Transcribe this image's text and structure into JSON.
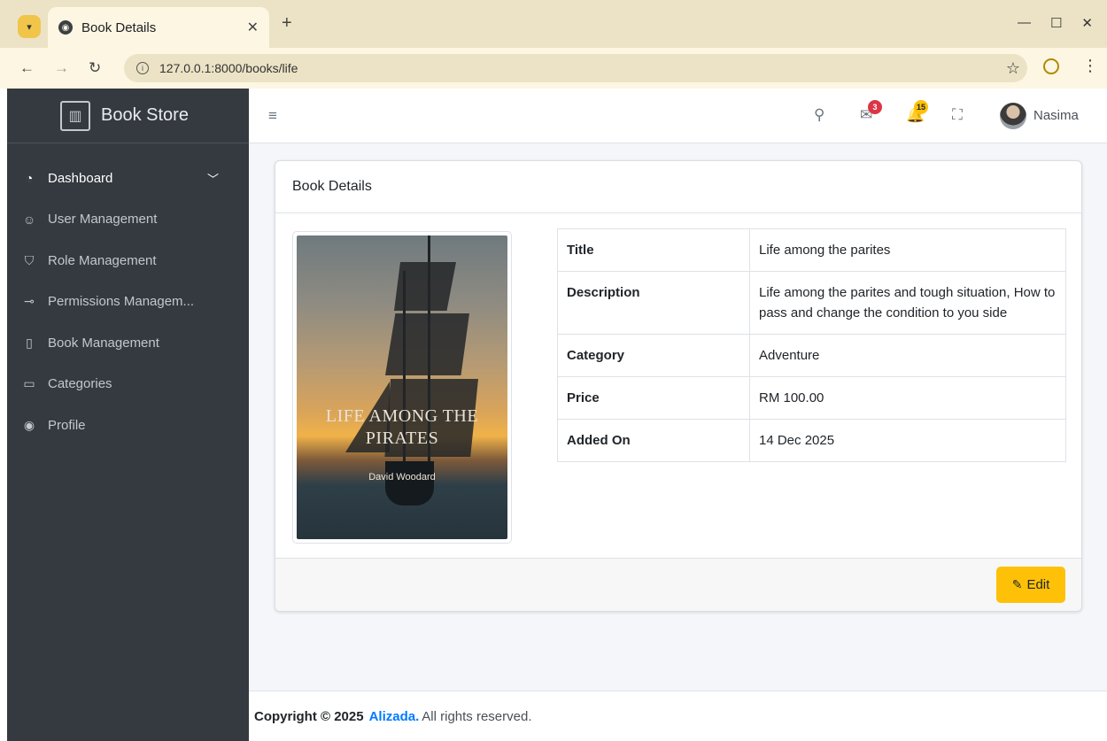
{
  "browser": {
    "tab_title": "Book Details",
    "url": "127.0.0.1:8000/books/life"
  },
  "sidebar": {
    "brand": "Book Store",
    "items": [
      {
        "label": "Dashboard",
        "icon": "gauge-icon"
      },
      {
        "label": "User Management",
        "icon": "users-icon"
      },
      {
        "label": "Role Management",
        "icon": "shield-icon"
      },
      {
        "label": "Permissions Managem...",
        "icon": "key-icon"
      },
      {
        "label": "Book Management",
        "icon": "book-open-icon"
      },
      {
        "label": "Categories",
        "icon": "folder-icon"
      },
      {
        "label": "Profile",
        "icon": "user-circle-icon"
      }
    ]
  },
  "topnav": {
    "messages_count": "3",
    "notifications_count": "15",
    "user_name": "Nasima"
  },
  "card": {
    "title": "Book Details",
    "cover": {
      "title_line1": "LIFE AMONG THE",
      "title_line2": "PIRATES",
      "author": "David Woodard"
    },
    "rows": [
      {
        "key": "Title",
        "value": "Life among the parites"
      },
      {
        "key": "Description",
        "value": "Life among the parites and tough situation, How to pass and change the condition to you side"
      },
      {
        "key": "Category",
        "value": "Adventure"
      },
      {
        "key": "Price",
        "value": "RM 100.00"
      },
      {
        "key": "Added On",
        "value": "14 Dec 2025"
      }
    ],
    "edit_label": "Edit"
  },
  "footer": {
    "copyright": "Copyright © 2025",
    "brand": "Alizada.",
    "suffix": "All rights reserved."
  },
  "colors": {
    "sidebar_bg": "#343a40",
    "edit_button": "#ffc107",
    "link": "#007bff",
    "badge_red": "#dc3545"
  }
}
